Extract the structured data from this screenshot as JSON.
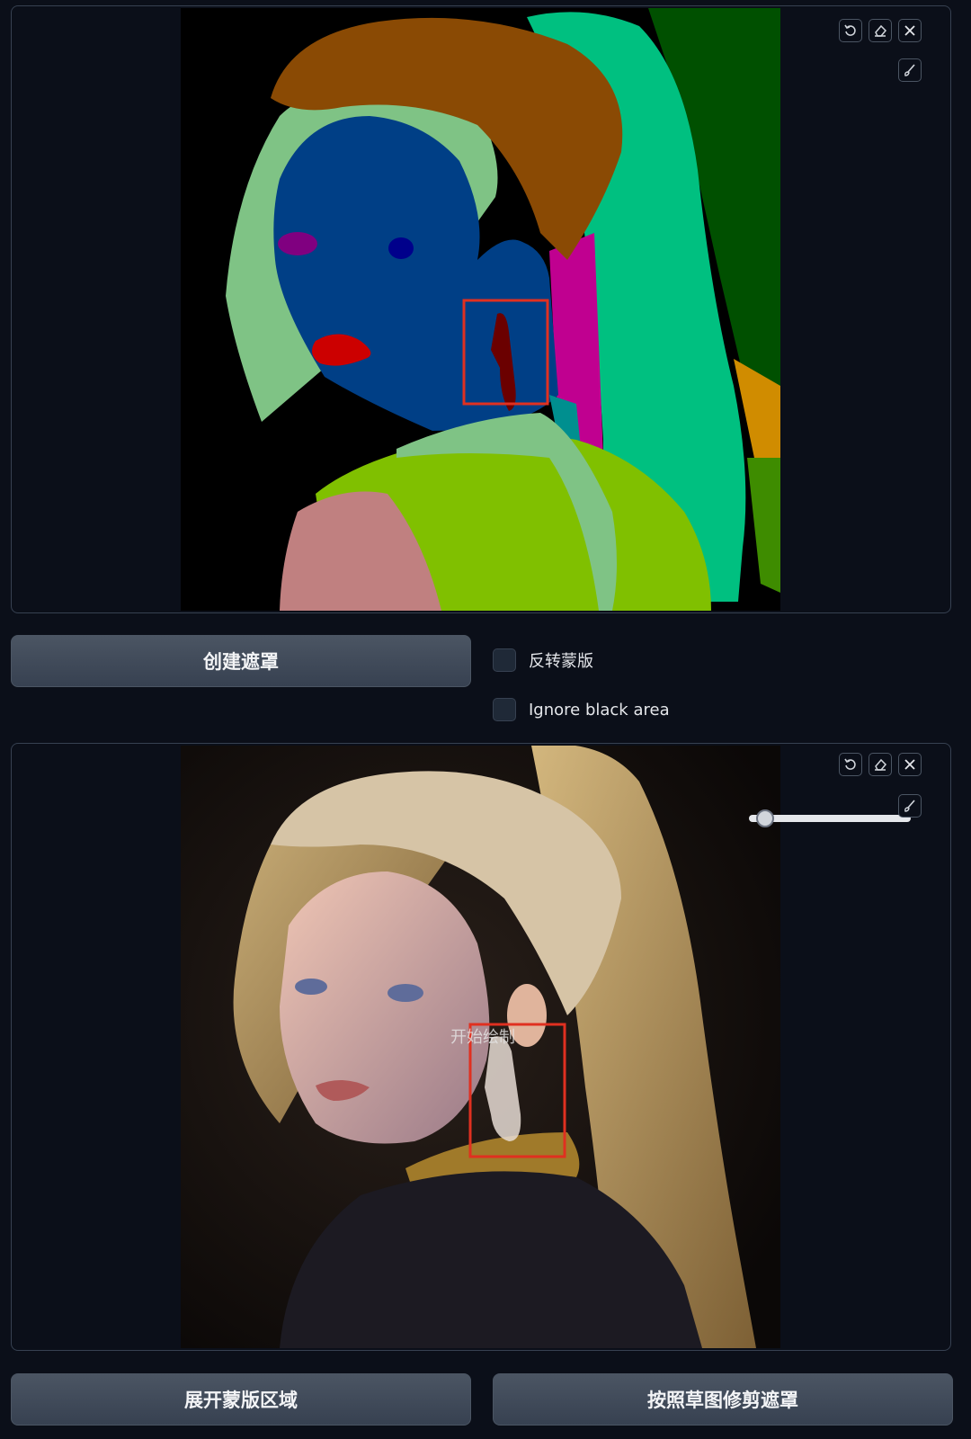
{
  "seg_panel": {
    "colors": {
      "background": "#000000",
      "hat": "#8a4a04",
      "hair": "#7fc385",
      "face": "#003f86",
      "lips": "#cc0000",
      "eyebrow": "#800080",
      "earring": "#6b0000",
      "ponytail": "#00c080",
      "dark_green": "#005000",
      "neck_pink": "#c00090",
      "shirt": "#80c000",
      "shoulder": "#c08080",
      "teal": "#008f8f",
      "orange": "#d08c00"
    }
  },
  "controls": {
    "create_mask": "创建遮罩",
    "invert_mask": "反转蒙版",
    "ignore_black": "Ignore black area"
  },
  "photo_panel": {
    "overlay_hint": "开始绘制",
    "brush_size": 0.05
  },
  "bottom": {
    "expand_mask": "展开蒙版区域",
    "trim_mask": "按照草图修剪遮罩"
  },
  "icons": [
    "undo-icon",
    "eraser-icon",
    "close-icon",
    "brush-icon"
  ]
}
